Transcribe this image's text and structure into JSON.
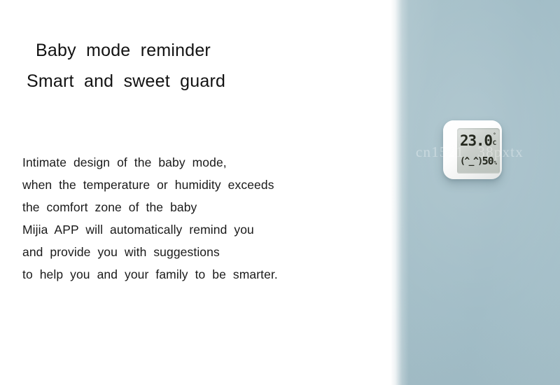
{
  "headline": {
    "line_1": "Baby  mode  reminder",
    "line_2": "Smart  and  sweet  guard"
  },
  "body": {
    "lines": [
      "Intimate  design  of  the  baby  mode,",
      "when  the  temperature  or  humidity  exceeds",
      "the  comfort  zone  of  the  baby",
      "Mijia  APP  will  automatically  remind  you",
      "and  provide  you  with  suggestions",
      "to  help  you  and  your  family  to  be  smarter."
    ]
  },
  "device": {
    "display": {
      "temperature": "23.0",
      "degree_symbol": "°",
      "temperature_unit": "C",
      "humidity_face": "(^_^)",
      "humidity": "50",
      "humidity_unit": "%"
    }
  },
  "watermark": {
    "text": "cn1521   38pxtx"
  },
  "colors": {
    "background": "#ffffff",
    "panel_blue": "#a2bdc7",
    "text": "#1a1a1a",
    "device_body": "#ffffff",
    "lcd": "#c9cec9",
    "lcd_text": "#25291f"
  }
}
